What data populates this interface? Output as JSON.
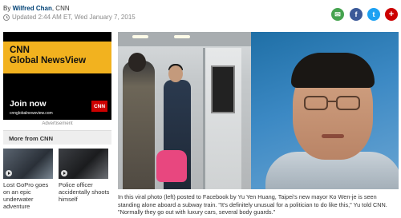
{
  "article": {
    "byline_prefix": "By",
    "author": "Wilfred Chan",
    "source": ", CNN",
    "updated": "Updated 2:44 AM ET, Wed January 7, 2015"
  },
  "share": {
    "email_glyph": "✉",
    "facebook_glyph": "f",
    "twitter_glyph": "t",
    "more_glyph": "+"
  },
  "ad": {
    "title_line1": "CNN",
    "title_line2": "Global NewsView",
    "cta": "Join now",
    "url": "cnnglobalnewsview.com",
    "logo": "CNN",
    "label": "Advertisement"
  },
  "more_from": {
    "heading": "More from CNN",
    "items": [
      {
        "title": "Lost GoPro goes on an epic underwater adventure"
      },
      {
        "title": "Police officer accidentally shoots himself"
      }
    ]
  },
  "photo": {
    "caption": "In this viral photo (left) posted to Facebook by Yu Yen Huang, Taipei's new mayor Ko Wen-je is seen standing alone aboard a subway train. \"It's definitely unusual for a politician to do like this,\" Yu told CNN. \"Normally they go out with luxury cars, several body guards.\""
  },
  "colors": {
    "author_link": "#004276",
    "email": "#45a34f",
    "facebook": "#3b5998",
    "twitter": "#1da1f2",
    "more": "#cc0000",
    "ad_accent": "#f2b21f",
    "cnn_red": "#cc0000"
  }
}
